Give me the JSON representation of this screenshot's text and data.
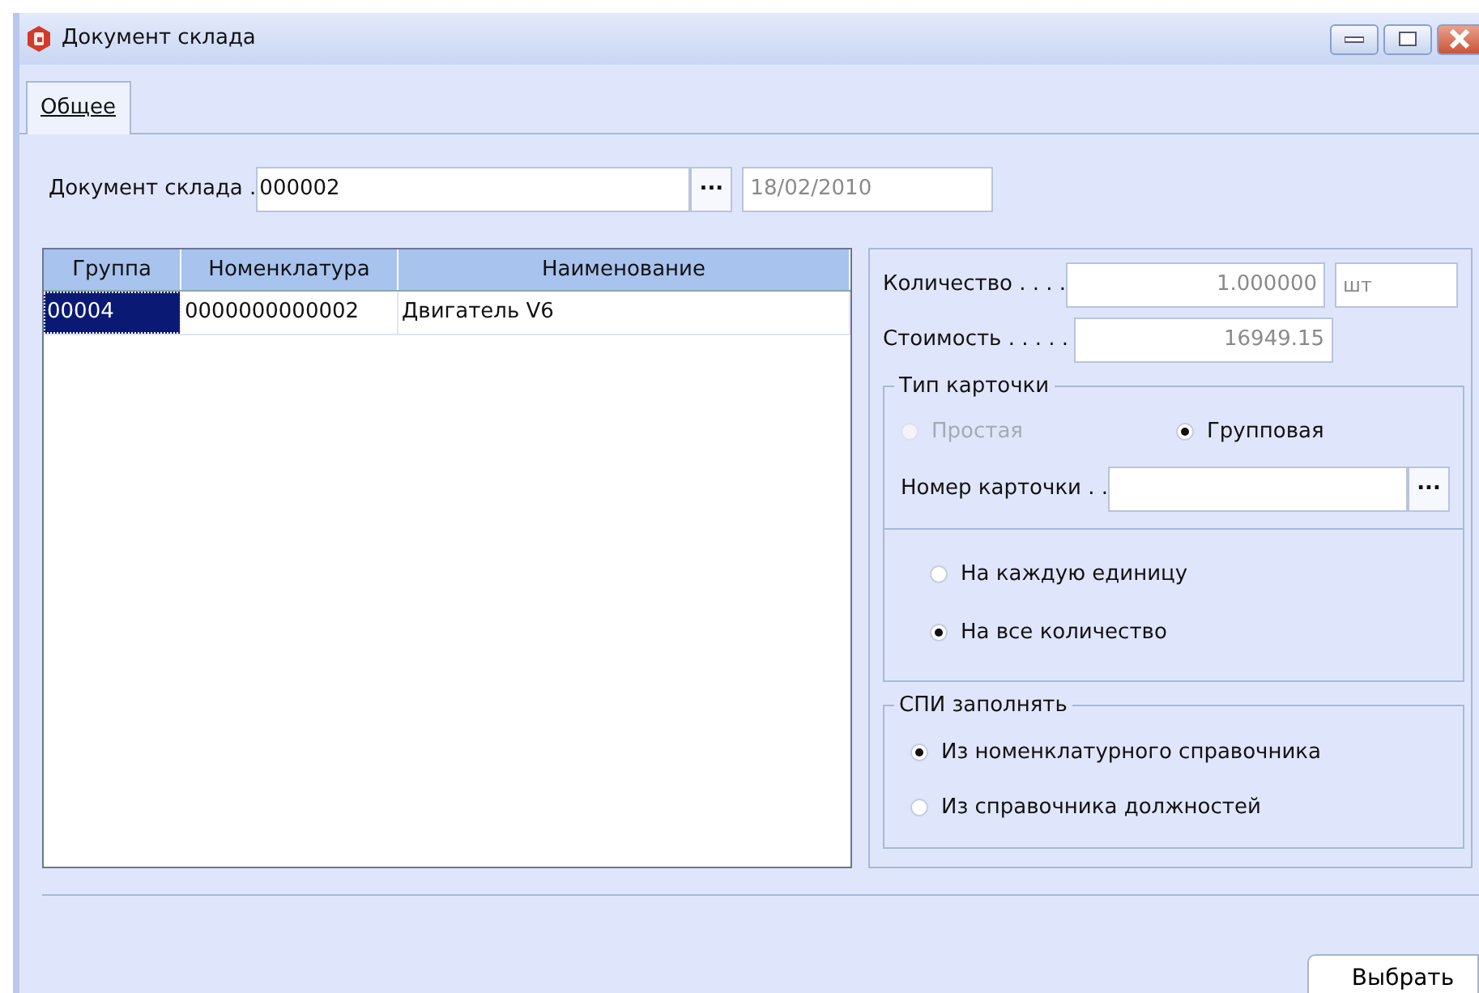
{
  "window": {
    "title": "Документ склада"
  },
  "tabs": [
    {
      "label": "Общее",
      "selected": true
    }
  ],
  "document": {
    "label": "Документ склада .",
    "value": "000002",
    "browse": "...",
    "date": "18/02/2010",
    "date_disabled": true
  },
  "table": {
    "columns": [
      "Группа",
      "Номенклатура",
      "Наименование"
    ],
    "rows": [
      {
        "cells": [
          "00004",
          "0000000000002",
          "Двигатель V6"
        ],
        "selected": true
      }
    ]
  },
  "quantity": {
    "label": "Количество . . . .",
    "value": "1.000000",
    "unit": "шт"
  },
  "cost": {
    "label": "Стоимость . . . . .",
    "value": "16949.15"
  },
  "card_type": {
    "title": "Тип карточки",
    "options": [
      {
        "label": "Простая",
        "selected": false,
        "disabled": true
      },
      {
        "label": "Групповая",
        "selected": true,
        "disabled": false
      }
    ],
    "card_number": {
      "label": "Номер карточки . .",
      "browse": "..."
    },
    "per_options": [
      {
        "label": "На каждую единицу",
        "selected": false
      },
      {
        "label": "На все количество",
        "selected": true
      }
    ]
  },
  "spi": {
    "title": "СПИ заполнять",
    "options": [
      {
        "label": "Из номенклатурного справочника",
        "selected": true
      },
      {
        "label": "Из справочника должностей",
        "selected": false
      }
    ]
  },
  "buttons": [
    "Выбрать"
  ]
}
